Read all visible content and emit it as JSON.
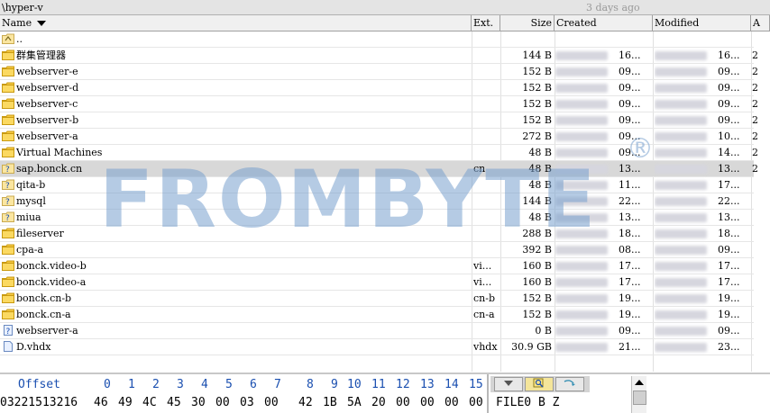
{
  "path_bar": {
    "path": "\\hyper-v",
    "modified_ago": "3 days ago"
  },
  "columns": {
    "name": "Name",
    "ext": "Ext.",
    "size": "Size",
    "created": "Created",
    "modified": "Modified",
    "attr": "A"
  },
  "files": [
    {
      "name": "..",
      "ext": "",
      "size": "",
      "created_time": "",
      "modified_time": "",
      "attr": "",
      "icon": "up-folder-icon"
    },
    {
      "name": "群集管理器",
      "ext": "",
      "size": "144 B",
      "created_time": "16...",
      "modified_time": "16...",
      "attr": "2",
      "icon": "folder-icon"
    },
    {
      "name": "webserver-e",
      "ext": "",
      "size": "152 B",
      "created_time": "09...",
      "modified_time": "09...",
      "attr": "2",
      "icon": "folder-icon"
    },
    {
      "name": "webserver-d",
      "ext": "",
      "size": "152 B",
      "created_time": "09...",
      "modified_time": "09...",
      "attr": "2",
      "icon": "folder-icon"
    },
    {
      "name": "webserver-c",
      "ext": "",
      "size": "152 B",
      "created_time": "09...",
      "modified_time": "09...",
      "attr": "2",
      "icon": "folder-icon"
    },
    {
      "name": "webserver-b",
      "ext": "",
      "size": "152 B",
      "created_time": "09...",
      "modified_time": "09...",
      "attr": "2",
      "icon": "folder-icon"
    },
    {
      "name": "webserver-a",
      "ext": "",
      "size": "272 B",
      "created_time": "09...",
      "modified_time": "10...",
      "attr": "2",
      "icon": "folder-icon"
    },
    {
      "name": "Virtual Machines",
      "ext": "",
      "size": "48 B",
      "created_time": "09...",
      "modified_time": "14...",
      "attr": "2",
      "icon": "folder-icon"
    },
    {
      "name": "sap.bonck.cn",
      "ext": "cn",
      "size": "48 B",
      "created_time": "13...",
      "modified_time": "13...",
      "attr": "2",
      "icon": "unknown-folder-icon",
      "selected": true
    },
    {
      "name": "qita-b",
      "ext": "",
      "size": "48 B",
      "created_time": "11...",
      "modified_time": "17...",
      "attr": "",
      "icon": "unknown-folder-icon"
    },
    {
      "name": "mysql",
      "ext": "",
      "size": "144 B",
      "created_time": "22...",
      "modified_time": "22...",
      "attr": "",
      "icon": "unknown-folder-icon"
    },
    {
      "name": "miua",
      "ext": "",
      "size": "48 B",
      "created_time": "13...",
      "modified_time": "13...",
      "attr": "",
      "icon": "unknown-folder-icon"
    },
    {
      "name": "fileserver",
      "ext": "",
      "size": "288 B",
      "created_time": "18...",
      "modified_time": "18...",
      "attr": "",
      "icon": "folder-icon"
    },
    {
      "name": "cpa-a",
      "ext": "",
      "size": "392 B",
      "created_time": "08...",
      "modified_time": "09...",
      "attr": "",
      "icon": "folder-icon"
    },
    {
      "name": "bonck.video-b",
      "ext": "vi...",
      "size": "160 B",
      "created_time": "17...",
      "modified_time": "17...",
      "attr": "",
      "icon": "folder-icon"
    },
    {
      "name": "bonck.video-a",
      "ext": "vi...",
      "size": "160 B",
      "created_time": "17...",
      "modified_time": "17...",
      "attr": "",
      "icon": "folder-icon"
    },
    {
      "name": "bonck.cn-b",
      "ext": "cn-b",
      "size": "152 B",
      "created_time": "19...",
      "modified_time": "19...",
      "attr": "",
      "icon": "folder-icon"
    },
    {
      "name": "bonck.cn-a",
      "ext": "cn-a",
      "size": "152 B",
      "created_time": "19...",
      "modified_time": "19...",
      "attr": "",
      "icon": "folder-icon"
    },
    {
      "name": "webserver-a",
      "ext": "",
      "size": "0 B",
      "created_time": "09...",
      "modified_time": "09...",
      "attr": "",
      "icon": "unknown-file-icon"
    },
    {
      "name": "D.vhdx",
      "ext": "vhdx",
      "size": "30.9 GB",
      "created_time": "21...",
      "modified_time": "23...",
      "attr": "",
      "icon": "file-icon"
    }
  ],
  "watermark": {
    "text": "FROMBYTE",
    "mark": "®"
  },
  "hex": {
    "offset_label": "Offset",
    "columns": [
      "0",
      "1",
      "2",
      "3",
      "4",
      "5",
      "6",
      "7",
      "8",
      "9",
      "10",
      "11",
      "12",
      "13",
      "14",
      "15"
    ],
    "row_offset": "03221513216",
    "row_bytes": [
      "46",
      "49",
      "4C",
      "45",
      "30",
      "00",
      "03",
      "00",
      "42",
      "1B",
      "5A",
      "20",
      "00",
      "00",
      "00",
      "00"
    ],
    "row_text": "FILE0   B Z"
  },
  "colors": {
    "folder": "#f5c842",
    "selected_row": "#d8d8d8",
    "hex_header": "#1a4fb0",
    "watermark": "#78a0cd"
  }
}
